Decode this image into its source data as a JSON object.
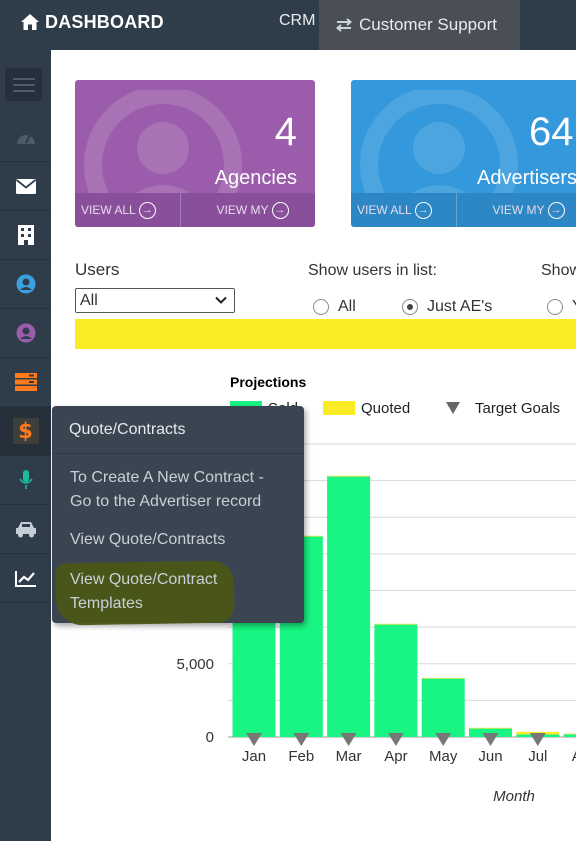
{
  "topbar": {
    "brand": "DASHBOARD",
    "crm": "CRM",
    "customer_support": "Customer Support"
  },
  "sidebar": {
    "items": [
      {
        "icon": "dashboard-gauge-icon"
      },
      {
        "icon": "envelope-icon"
      },
      {
        "icon": "building-icon"
      },
      {
        "icon": "user-circle-icon",
        "color": "#3aa0e0"
      },
      {
        "icon": "user-circle-icon",
        "color": "#9b5dab"
      },
      {
        "icon": "stack-icon",
        "color": "#ff7a1a"
      },
      {
        "icon": "dollar-icon",
        "color": "#ff7a1a"
      },
      {
        "icon": "microphone-icon",
        "color": "#1abc9c"
      },
      {
        "icon": "car-icon"
      },
      {
        "icon": "line-chart-icon"
      }
    ]
  },
  "cards": {
    "agencies": {
      "count": "4",
      "label": "Agencies",
      "view_all": "VIEW ALL",
      "view_my": "VIEW MY",
      "color": "#9b5dab"
    },
    "advertisers": {
      "count": "64",
      "label": "Advertisers",
      "view_all": "VIEW ALL",
      "view_my": "VIEW MY",
      "color": "#3398dc"
    }
  },
  "filters": {
    "users_label": "Users",
    "users_selected": "All",
    "show_users_label": "Show users in list:",
    "show_label_2": "Show",
    "radios": [
      {
        "label": "All",
        "checked": false
      },
      {
        "label": "Just AE's",
        "checked": true
      },
      {
        "label": "Y",
        "checked": false
      }
    ]
  },
  "popup_menu": {
    "header": "Quote/Contracts",
    "items": [
      {
        "line1": "To Create A New Contract -",
        "line2": "Go to the Advertiser record"
      },
      {
        "line1": "View Quote/Contracts"
      },
      {
        "line1": "View Quote/Contract",
        "line2": "Templates",
        "highlighted": true
      }
    ]
  },
  "chart_data": {
    "type": "bar",
    "title": "Projections",
    "xlabel": "Month",
    "ylabel": "",
    "legend": [
      "Sold",
      "Quoted",
      "Target Goals"
    ],
    "categories": [
      "Jan",
      "Feb",
      "Mar",
      "Apr",
      "May",
      "Jun",
      "Jul",
      "Aug"
    ],
    "series": [
      {
        "name": "Sold",
        "color": "#18f582",
        "values": [
          12400,
          13700,
          17800,
          7700,
          4000,
          600,
          200,
          200
        ]
      },
      {
        "name": "Quoted",
        "color": "#fbeb27",
        "values": [
          0,
          0,
          0,
          0,
          0,
          0,
          150,
          0
        ]
      }
    ],
    "target_goals": {
      "name": "Target Goals",
      "values": [
        0,
        0,
        0,
        0,
        0,
        0,
        0,
        0
      ]
    },
    "y_ticks": [
      "0",
      "5,000"
    ],
    "ylim": [
      0,
      20000
    ],
    "grid": true
  }
}
